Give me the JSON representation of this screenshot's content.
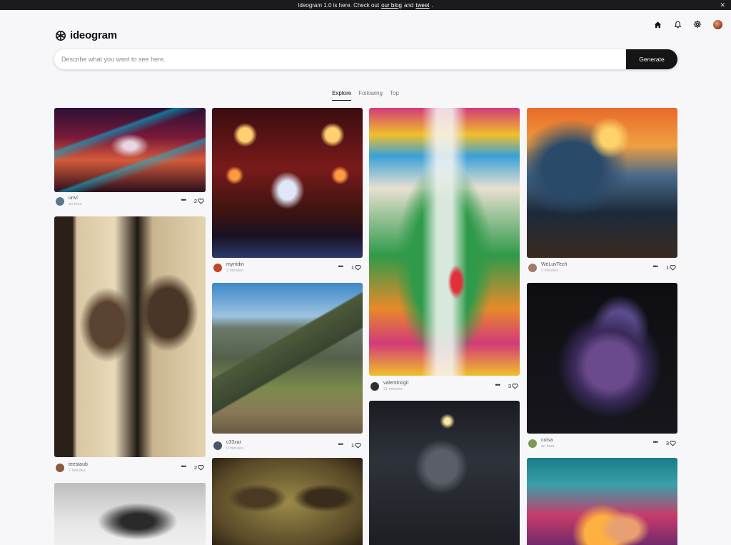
{
  "announcement": {
    "prefix": "Ideogram 1.0 is here. Check out",
    "link1": "our blog",
    "mid": "and",
    "link2": "tweet",
    "suffix": "."
  },
  "app": {
    "name": "ideogram"
  },
  "nav_icons": [
    "home-icon",
    "bell-icon",
    "gear-icon",
    "avatar"
  ],
  "search": {
    "placeholder": "Describe what you want to see here.",
    "value": "",
    "button": "Generate"
  },
  "tabs": [
    "Explore",
    "Following",
    "Top"
  ],
  "active_tab": "Explore",
  "posts": [
    {
      "user": "unvi",
      "time": "an hour",
      "likes": "2",
      "avatar_color": "#5a7a8c"
    },
    {
      "user": "teestaub",
      "time": "7 minutes",
      "likes": "2",
      "avatar_color": "#8c5a3c"
    },
    {
      "user": "myrridin",
      "time": "2 minutes",
      "likes": "1",
      "avatar_color": "#c0462a"
    },
    {
      "user": "c33xar",
      "time": "9 minutes",
      "likes": "1",
      "avatar_color": "#4a5568"
    },
    {
      "user": "valentinogil",
      "time": "31 minutes",
      "likes": "3",
      "avatar_color": "#2d2d33"
    },
    {
      "user": "WeLuvTech",
      "time": "2 minutes",
      "likes": "1",
      "avatar_color": "#a07b6a"
    },
    {
      "user": "coisa",
      "time": "an hour",
      "likes": "3",
      "avatar_color": "#7a9a5a"
    }
  ]
}
